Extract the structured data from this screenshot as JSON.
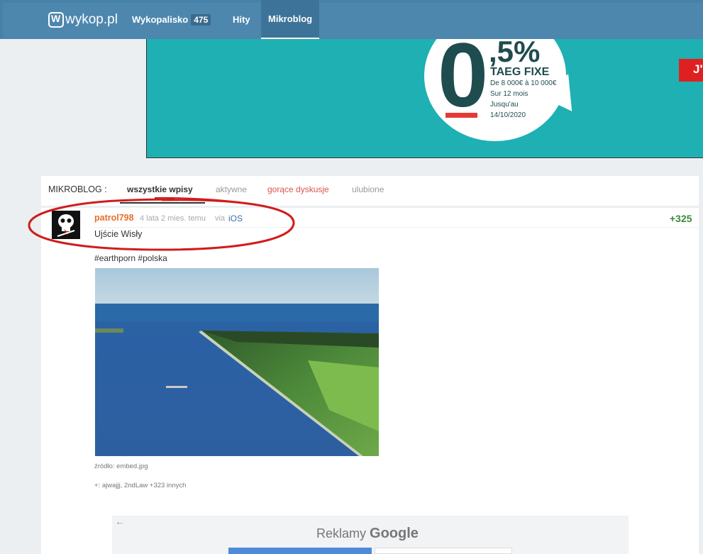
{
  "header": {
    "logo_text": "wykop.pl",
    "nav": [
      {
        "label": "Wykopalisko",
        "badge": "475"
      },
      {
        "label": "Hity"
      },
      {
        "label": "Mikroblog",
        "active": true
      }
    ]
  },
  "ad": {
    "big_digit": "0",
    "rate": ",5%",
    "title": "TAEG FIXE",
    "lines": [
      "De 8 000€ à 10 000€",
      "Sur 12 mois",
      "Jusqu'au",
      "14/10/2020"
    ],
    "cta": "J'"
  },
  "tabs": {
    "prefix": "MIKROBLOG :",
    "items": [
      {
        "label": "wszystkie wpisy",
        "active": true
      },
      {
        "label": "aktywne"
      },
      {
        "label": "gorące dyskusje"
      },
      {
        "label": "ulubione"
      }
    ]
  },
  "entry": {
    "author": "patrol798",
    "time": "4 lata 2 mies. temu",
    "via": "via",
    "client": "iOS",
    "score": "+325",
    "text": "Ujście Wisły",
    "tags": [
      "earthporn",
      "polska"
    ],
    "source": "źródło: embed.jpg",
    "voters": "+: ajwajjj, 2ndLaw +323 innych"
  },
  "google_ads": {
    "back_arrow": "←",
    "label_prefix": "Reklamy",
    "label_brand": "Google"
  },
  "colors": {
    "nav_bg": "#4d87ae",
    "ad_bg": "#1fb0b3",
    "author": "#e66f2b",
    "link": "#3a6fa6",
    "score": "#3a8a3a",
    "annotation": "#d01c1c"
  }
}
